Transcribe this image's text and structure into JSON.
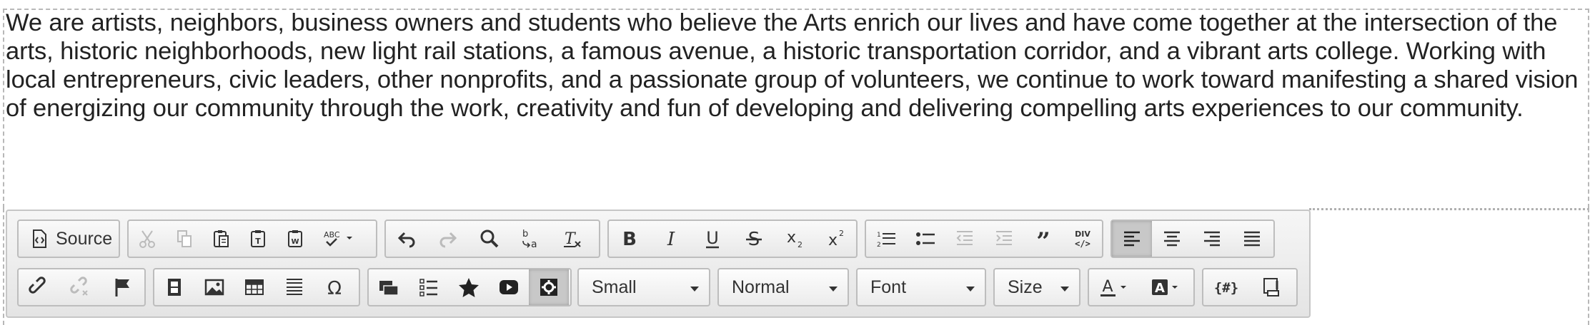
{
  "content": {
    "paragraph": "We are artists, neighbors, business owners and students who believe the Arts enrich our lives and have come together at the intersection of the arts, historic neighborhoods, new light rail stations, a famous avenue, a historic transportation corridor, and a vibrant arts college. Working with local entrepreneurs, civic leaders, other nonprofits, and a passionate group of volunteers, we continue to work toward manifesting a shared vision of energizing our community through the work, creativity and fun of developing and delivering compelling arts experiences to our community."
  },
  "toolbar": {
    "source_label": "Source",
    "format_combo": "Small",
    "style_combo": "Normal",
    "font_combo": "Font",
    "size_combo": "Size"
  },
  "icons": [
    "source-icon",
    "cut-icon",
    "copy-icon",
    "paste-icon",
    "paste-text-icon",
    "paste-word-icon",
    "spellcheck-icon",
    "undo-icon",
    "redo-icon",
    "find-icon",
    "replace-icon",
    "remove-format-icon",
    "bold-icon",
    "italic-icon",
    "underline-icon",
    "strike-icon",
    "subscript-icon",
    "superscript-icon",
    "numbered-list-icon",
    "bulleted-list-icon",
    "outdent-icon",
    "indent-icon",
    "blockquote-icon",
    "div-icon",
    "align-left-icon",
    "align-center-icon",
    "align-right-icon",
    "justify-icon",
    "link-icon",
    "unlink-icon",
    "anchor-icon",
    "video-icon",
    "image-icon",
    "table-icon",
    "horizontal-rule-icon",
    "special-char-icon",
    "templates-icon",
    "checklist-icon",
    "star-icon",
    "youtube-icon",
    "widget-icon",
    "text-color-icon",
    "bg-color-icon",
    "placeholder-icon",
    "show-blocks-icon"
  ],
  "colors": {
    "toolbar_bg": "#e8e8e8",
    "active_button": "#c8c8c8",
    "text": "#222222"
  }
}
